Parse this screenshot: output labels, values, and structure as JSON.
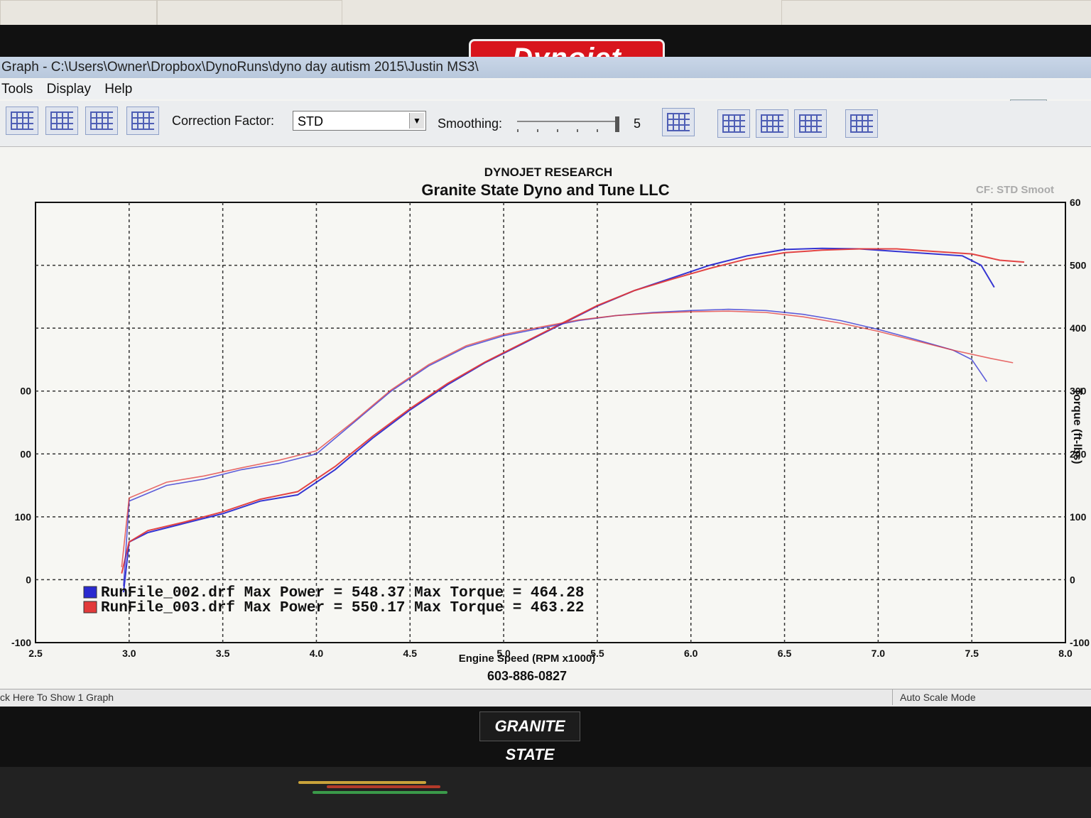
{
  "window": {
    "title": "Graph - C:\\Users\\Owner\\Dropbox\\DynoRuns\\dyno day autism 2015\\Justin MS3\\"
  },
  "brand": {
    "monitor_logo": "Dynojet",
    "bottom_logo": "GRANITE STATE"
  },
  "menu": [
    "Tools",
    "Display",
    "Help"
  ],
  "toolbar": {
    "correction_label": "Correction Factor:",
    "correction_value": "STD",
    "smoothing_label": "Smoothing:",
    "smoothing_value": "5"
  },
  "status": {
    "left": "ck Here To Show 1 Graph",
    "right": "Auto Scale Mode"
  },
  "colors": {
    "run1": "#2a2ad0",
    "run2": "#e23a3a"
  },
  "chart_data": {
    "type": "line",
    "supertitle": "DYNOJET RESEARCH",
    "title": "Granite State Dyno and Tune LLC",
    "corner_note": "CF: STD  Smoot",
    "xlabel": "Engine Speed (RPM x1000)",
    "ylabel_right": "Torque (ft-lbs)",
    "footer": "603-886-0827",
    "xlim": [
      2.5,
      8.0
    ],
    "x_ticks": [
      "2.5",
      "3.0",
      "3.5",
      "4.0",
      "4.5",
      "5.0",
      "5.5",
      "6.0",
      "6.5",
      "7.0",
      "7.5",
      "8.0"
    ],
    "y_left_ticks": [
      "-100",
      "0",
      "100",
      "00",
      "00"
    ],
    "y_right_ticks": [
      "-100",
      "0",
      "100",
      "200",
      "300",
      "400",
      "500",
      "60"
    ],
    "ylim": [
      -100,
      600
    ],
    "grid": true,
    "series": [
      {
        "name": "RunFile_002.drf",
        "kind": "power",
        "x": [
          2.97,
          3.0,
          3.1,
          3.3,
          3.5,
          3.7,
          3.9,
          4.1,
          4.3,
          4.5,
          4.7,
          4.9,
          5.1,
          5.3,
          5.5,
          5.7,
          5.9,
          6.1,
          6.3,
          6.5,
          6.7,
          6.9,
          7.1,
          7.3,
          7.45,
          7.55,
          7.62
        ],
        "y": [
          -20,
          60,
          75,
          90,
          105,
          125,
          135,
          175,
          225,
          270,
          310,
          345,
          375,
          405,
          435,
          460,
          480,
          500,
          515,
          525,
          527,
          526,
          522,
          518,
          515,
          500,
          465
        ]
      },
      {
        "name": "RunFile_003.drf",
        "kind": "power",
        "x": [
          2.96,
          3.0,
          3.1,
          3.3,
          3.5,
          3.7,
          3.9,
          4.1,
          4.3,
          4.5,
          4.7,
          4.9,
          5.1,
          5.3,
          5.5,
          5.7,
          5.9,
          6.1,
          6.3,
          6.5,
          6.7,
          6.9,
          7.1,
          7.3,
          7.5,
          7.65,
          7.78
        ],
        "y": [
          10,
          60,
          78,
          92,
          108,
          128,
          140,
          180,
          228,
          272,
          312,
          346,
          376,
          406,
          436,
          460,
          478,
          495,
          510,
          520,
          524,
          526,
          526,
          522,
          518,
          508,
          505
        ]
      },
      {
        "name": "RunFile_002.drf",
        "kind": "torque",
        "x": [
          2.97,
          3.0,
          3.2,
          3.4,
          3.6,
          3.8,
          4.0,
          4.2,
          4.4,
          4.6,
          4.8,
          5.0,
          5.2,
          5.4,
          5.6,
          5.8,
          6.0,
          6.2,
          6.4,
          6.6,
          6.8,
          7.0,
          7.2,
          7.4,
          7.5,
          7.58
        ],
        "y": [
          -10,
          125,
          150,
          160,
          175,
          185,
          200,
          250,
          300,
          340,
          370,
          388,
          400,
          412,
          420,
          425,
          428,
          430,
          428,
          422,
          412,
          398,
          382,
          365,
          350,
          315
        ]
      },
      {
        "name": "RunFile_003.drf",
        "kind": "torque",
        "x": [
          2.96,
          3.0,
          3.2,
          3.4,
          3.6,
          3.8,
          4.0,
          4.2,
          4.4,
          4.6,
          4.8,
          5.0,
          5.2,
          5.4,
          5.6,
          5.8,
          6.0,
          6.2,
          6.4,
          6.6,
          6.8,
          7.0,
          7.2,
          7.4,
          7.6,
          7.72
        ],
        "y": [
          20,
          130,
          155,
          165,
          178,
          190,
          205,
          252,
          302,
          342,
          372,
          390,
          402,
          413,
          420,
          424,
          426,
          427,
          425,
          418,
          408,
          395,
          380,
          365,
          352,
          345
        ]
      }
    ],
    "legend": [
      {
        "file": "RunFile_002.drf",
        "text": "RunFile_002.drf Max Power = 548.37 Max Torque = 464.28"
      },
      {
        "file": "RunFile_003.drf",
        "text": "RunFile_003.drf Max Power = 550.17 Max Torque = 463.22"
      }
    ]
  }
}
